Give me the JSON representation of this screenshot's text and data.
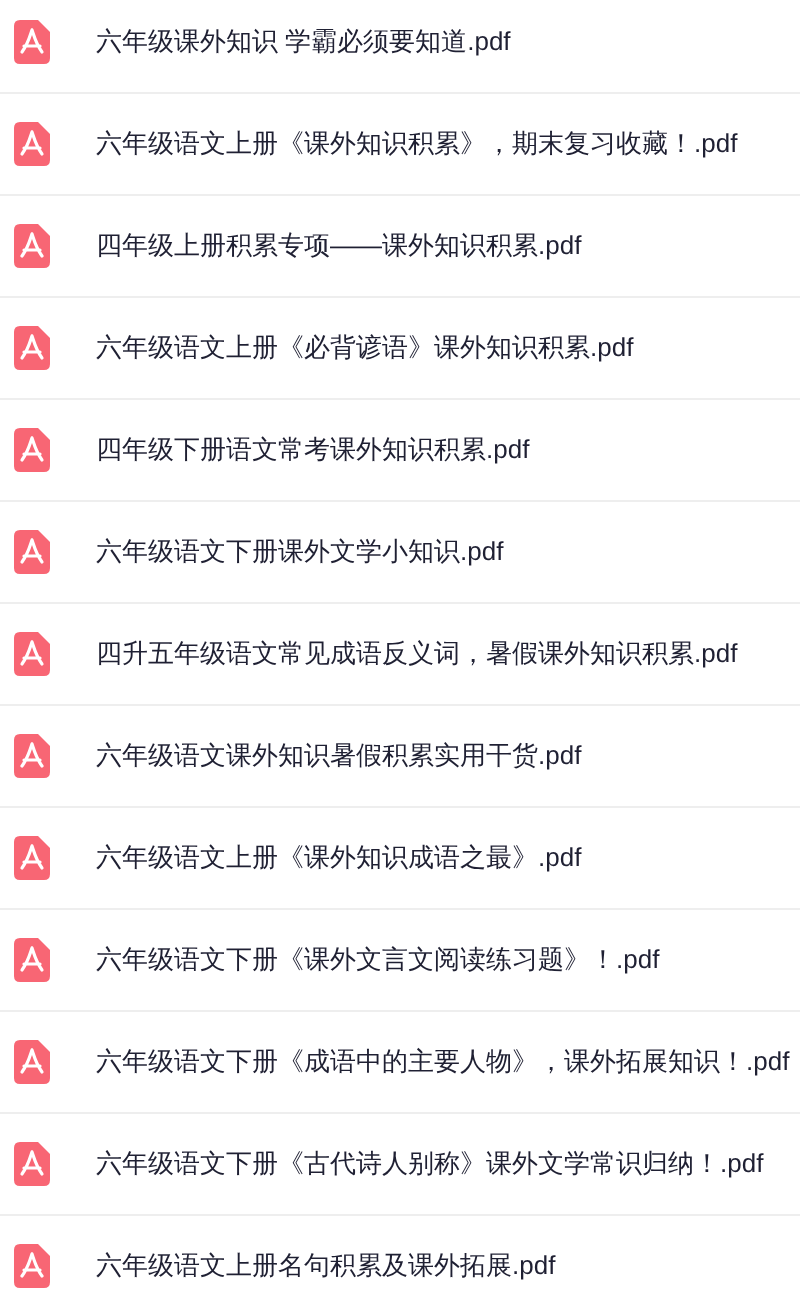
{
  "files": [
    {
      "name": "六年级课外知识 学霸必须要知道.pdf"
    },
    {
      "name": "六年级语文上册《课外知识积累》，期末复习收藏！.pdf"
    },
    {
      "name": "四年级上册积累专项——课外知识积累.pdf"
    },
    {
      "name": "六年级语文上册《必背谚语》课外知识积累.pdf"
    },
    {
      "name": "四年级下册语文常考课外知识积累.pdf"
    },
    {
      "name": "六年级语文下册课外文学小知识.pdf"
    },
    {
      "name": "四升五年级语文常见成语反义词，暑假课外知识积累.pdf"
    },
    {
      "name": "六年级语文课外知识暑假积累实用干货.pdf"
    },
    {
      "name": "六年级语文上册《课外知识成语之最》.pdf"
    },
    {
      "name": "六年级语文下册《课外文言文阅读练习题》！.pdf"
    },
    {
      "name": "六年级语文下册《成语中的主要人物》，课外拓展知识！.pdf"
    },
    {
      "name": "六年级语文下册《古代诗人别称》课外文学常识归纳！.pdf"
    },
    {
      "name": "六年级语文上册名句积累及课外拓展.pdf"
    }
  ]
}
